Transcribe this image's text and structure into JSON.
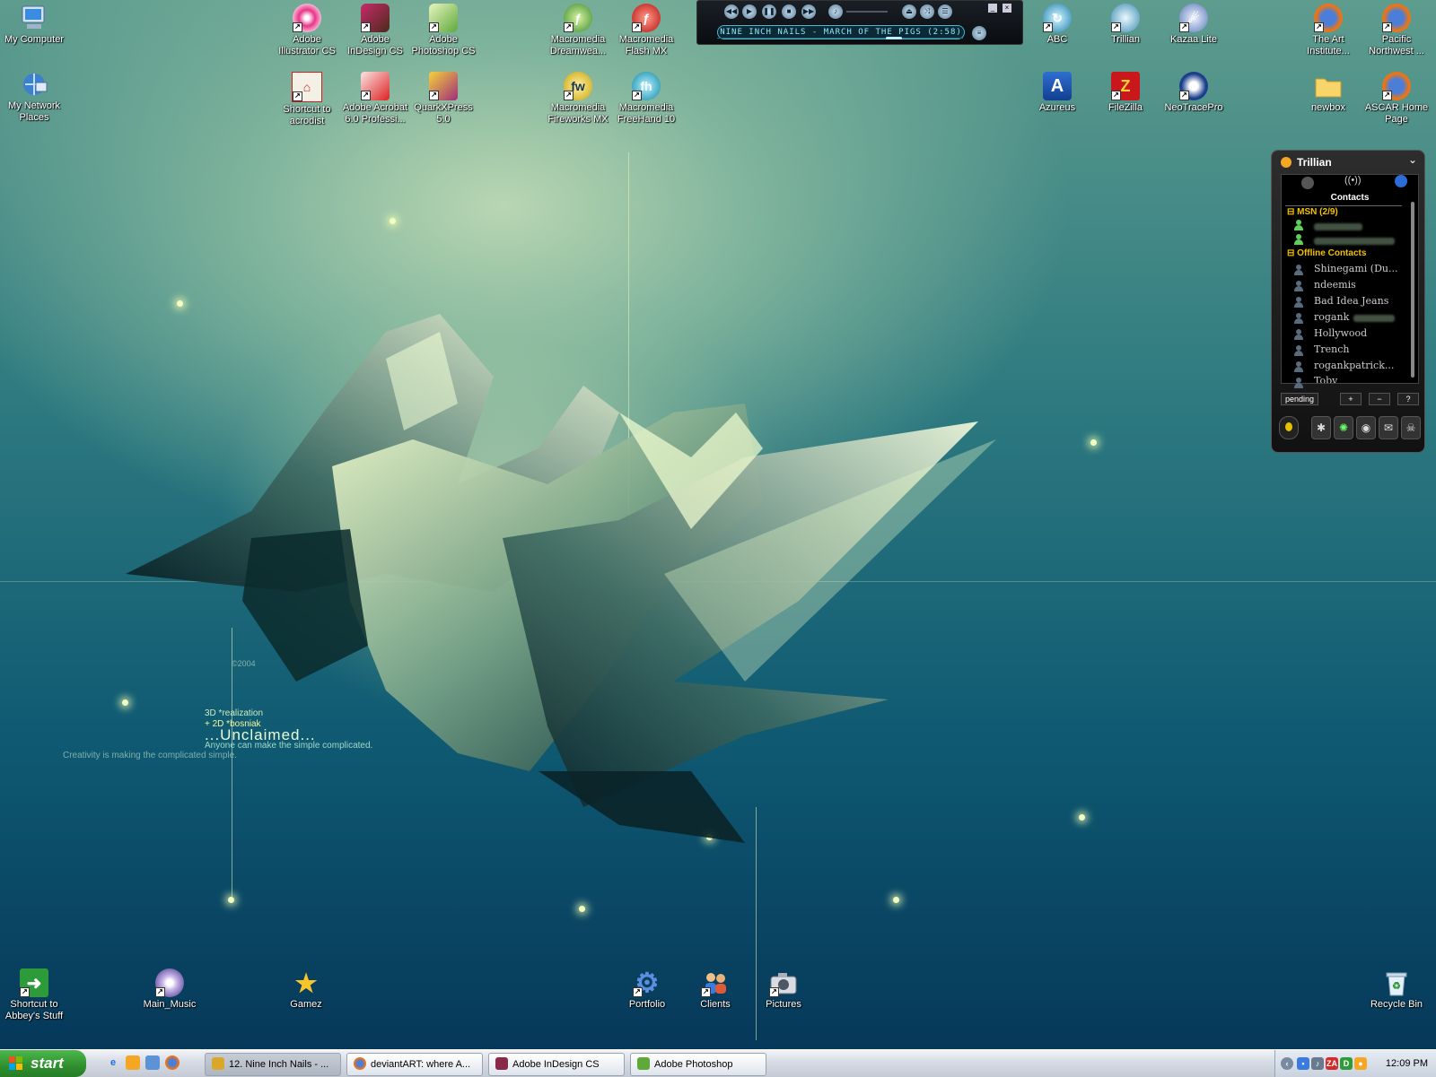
{
  "desktop_icons": {
    "my_computer": "My Computer",
    "network": "My Network Places",
    "illustrator": "Adobe Illustrator CS",
    "indesign": "Adobe InDesign CS",
    "photoshop": "Adobe Photoshop CS",
    "acrodist": "Shortcut to acrodist",
    "acrobat": "Adobe Acrobat 6.0 Professi...",
    "quark": "QuarkXPress 5.0",
    "dreamweaver": "Macromedia Dreamwea...",
    "flash": "Macromedia Flash MX",
    "fireworks": "Macromedia Fireworks MX",
    "freehand": "Macromedia FreeHand 10",
    "abc": "ABC",
    "trillian": "Trillian",
    "kazaa": "Kazaa Lite",
    "art_institute": "The Art Institute...",
    "pacific_nw": "Pacific Northwest ...",
    "azureus": "Azureus",
    "filezilla": "FileZilla",
    "neotrace": "NeoTracePro",
    "newbox": "newbox",
    "ascar": "ASCAR Home Page",
    "abbey": "Shortcut to Abbey's Stuff",
    "main_music": "Main_Music",
    "gamez": "Gamez",
    "portfolio": "Portfolio",
    "clients": "Clients",
    "pictures": "Pictures",
    "recycle": "Recycle Bin"
  },
  "player": {
    "track": "NINE INCH NAILS - MARCH OF THE PIGS (2:58)",
    "seek_fraction": 0.72
  },
  "wallpaper": {
    "version_mark": "©2004",
    "line1": "3D *realization",
    "line2": "+ 2D *bosniak",
    "title": "...Unclaimed...",
    "subtitle": "Anyone can make the simple complicated.",
    "creativity": "Creativity is making the complicated simple."
  },
  "trillian": {
    "title": "Trillian",
    "contacts_header": "Contacts",
    "msn_group": "MSN (2/9)",
    "offline_group": "Offline Contacts",
    "offline": [
      "Shinegami (Du...",
      "ndeemis",
      "Bad Idea Jeans",
      "rogank",
      "Hollywood",
      "Trench",
      "rogankpatrick...",
      "Toby"
    ],
    "pending": "pending",
    "add": "+",
    "remove": "−",
    "help": "?"
  },
  "taskbar": {
    "start": "start",
    "tasks": [
      "12. Nine Inch Nails - ...",
      "deviantART: where A...",
      "Adobe InDesign CS",
      "Adobe Photoshop"
    ],
    "clock": "12:09 PM"
  },
  "colors": {
    "start_green": "#2f8f2f",
    "trillian_group": "#f5c000",
    "player_text": "#8fe8ff"
  }
}
